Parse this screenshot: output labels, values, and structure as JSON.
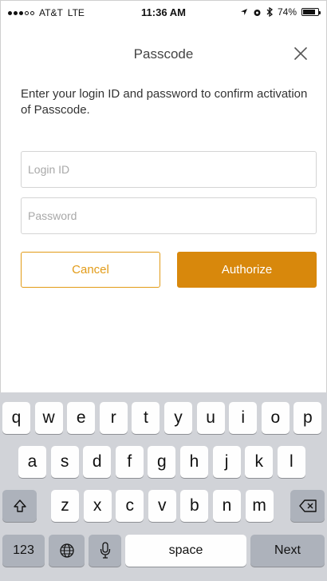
{
  "status_bar": {
    "carrier": "AT&T",
    "network": "LTE",
    "time": "11:36 AM",
    "battery": "74%",
    "battery_level": 0.74,
    "signal_bars_filled": 3,
    "signal_bars_total": 5
  },
  "nav": {
    "title": "Passcode",
    "close_icon": "close-icon"
  },
  "instructions": "Enter your login ID and password to confirm activation of Passcode.",
  "form": {
    "login_placeholder": "Login ID",
    "login_value": "",
    "password_placeholder": "Password",
    "password_value": ""
  },
  "buttons": {
    "cancel": "Cancel",
    "authorize": "Authorize"
  },
  "colors": {
    "accent": "#d8880c",
    "accent_border": "#e29b17",
    "keyboard_bg": "#d1d3d8",
    "func_key_bg": "#adb2bb"
  },
  "keyboard": {
    "row1": [
      "q",
      "w",
      "e",
      "r",
      "t",
      "y",
      "u",
      "i",
      "o",
      "p"
    ],
    "row2": [
      "a",
      "s",
      "d",
      "f",
      "g",
      "h",
      "j",
      "k",
      "l"
    ],
    "row3": [
      "z",
      "x",
      "c",
      "v",
      "b",
      "n",
      "m"
    ],
    "numbers_key": "123",
    "space_key": "space",
    "next_key": "Next"
  }
}
